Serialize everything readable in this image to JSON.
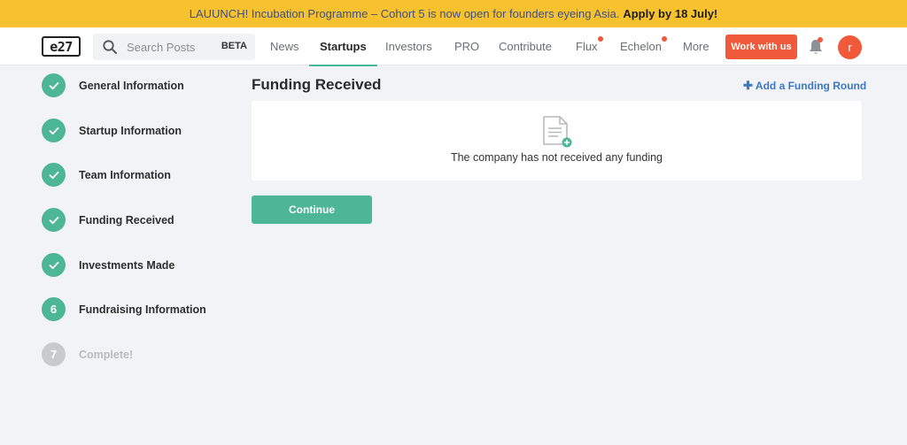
{
  "banner": {
    "message": "LAUUNCH! Incubation Programme – Cohort 5 is now open for founders eyeing Asia.",
    "cta": "Apply by 18 July!"
  },
  "header": {
    "logo_text": "e27",
    "search": {
      "placeholder": "Search Posts",
      "badge": "BETA"
    },
    "nav": [
      {
        "label": "News"
      },
      {
        "label": "Startups",
        "active": true
      },
      {
        "label": "Investors"
      },
      {
        "label": "PRO"
      },
      {
        "label": "Contribute"
      },
      {
        "label": "Flux",
        "dot": true
      },
      {
        "label": "Echelon",
        "dot": true
      },
      {
        "label": "More"
      }
    ],
    "work_button": "Work with us",
    "avatar_initial": "r",
    "accent_color": "#f0593a"
  },
  "steps": [
    {
      "number": "",
      "label": "General Information",
      "status": "done"
    },
    {
      "number": "",
      "label": "Startup Information",
      "status": "done"
    },
    {
      "number": "",
      "label": "Team Information",
      "status": "done"
    },
    {
      "number": "",
      "label": "Funding Received",
      "status": "done"
    },
    {
      "number": "",
      "label": "Investments Made",
      "status": "done"
    },
    {
      "number": "6",
      "label": "Fundraising Information",
      "status": "current"
    },
    {
      "number": "7",
      "label": "Complete!",
      "status": "pending"
    }
  ],
  "main": {
    "title": "Funding Received",
    "add_link": "Add a Funding Round",
    "empty_message": "The company has not received any funding",
    "continue_button": "Continue",
    "brand_color": "#4db695"
  }
}
